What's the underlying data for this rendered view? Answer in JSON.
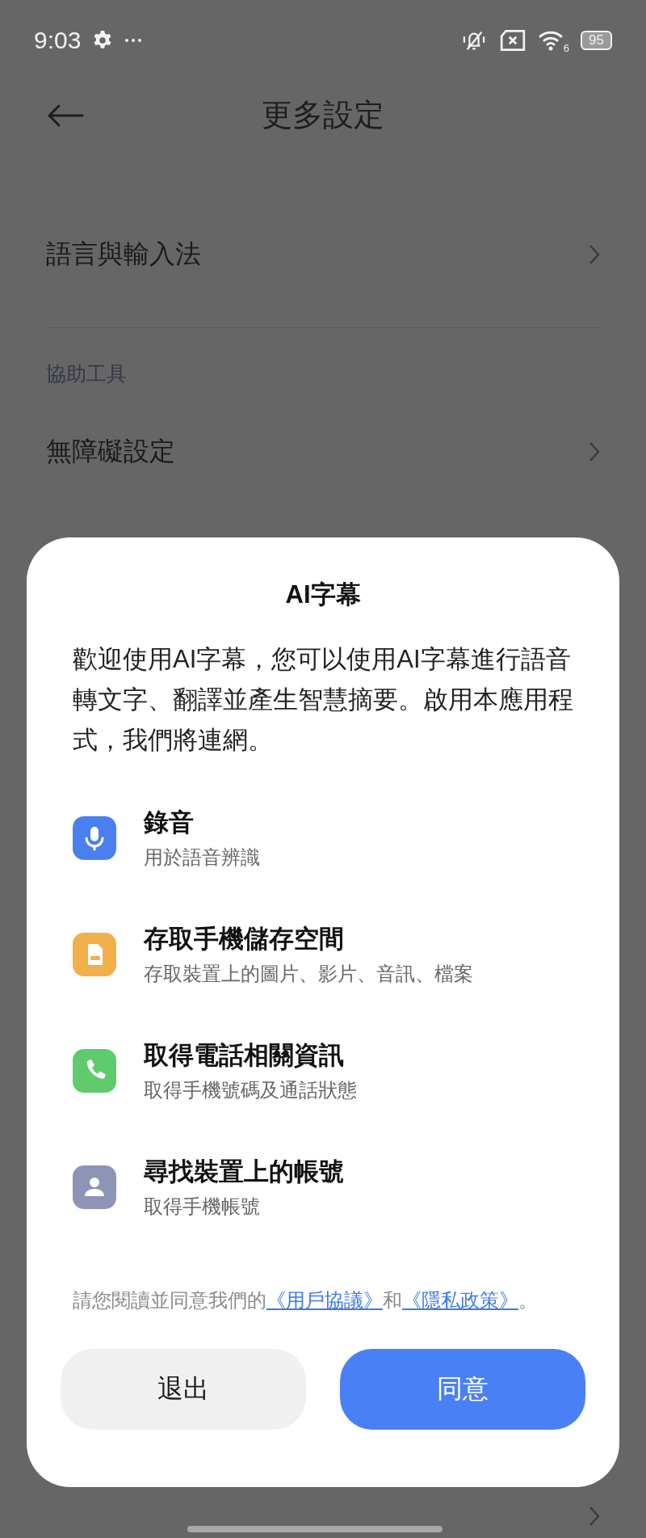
{
  "status_bar": {
    "time": "9:03",
    "wifi_generation": "6",
    "battery": "95"
  },
  "header": {
    "title": "更多設定"
  },
  "settings": [
    {
      "kind": "hidden_row"
    },
    {
      "kind": "row",
      "label": "語言與輸入法"
    },
    {
      "kind": "section",
      "label": "協助工具"
    },
    {
      "kind": "row",
      "label": "無障礙設定"
    },
    {
      "kind": "hidden_row"
    }
  ],
  "dialog": {
    "title": "AI字幕",
    "intro": "歡迎使用AI字幕，您可以使用AI字幕進行語音轉文字、翻譯並產生智慧摘要。啟用本應用程式，我們將連網。",
    "permissions": [
      {
        "kind": "microphone",
        "color": "#4a7ff0",
        "title": "錄音",
        "description": "用於語音辨識"
      },
      {
        "kind": "storage",
        "color": "#f2b04a",
        "title": "存取手機儲存空間",
        "description": "存取裝置上的圖片、影片、音訊、檔案"
      },
      {
        "kind": "phone",
        "color": "#5fcb6c",
        "title": "取得電話相關資訊",
        "description": "取得手機號碼及通話狀態"
      },
      {
        "kind": "account",
        "color": "#8e94b5",
        "title": "尋找裝置上的帳號",
        "description": "取得手機帳號"
      }
    ],
    "agreement": {
      "before": "請您閱讀並同意我們的",
      "link_1": "《用戶協議》",
      "joiner": "和",
      "link_2": "《隱私政策》",
      "end": "。"
    },
    "buttons": [
      {
        "kind": "secondary",
        "label": "退出"
      },
      {
        "kind": "primary",
        "label": "同意"
      }
    ]
  }
}
